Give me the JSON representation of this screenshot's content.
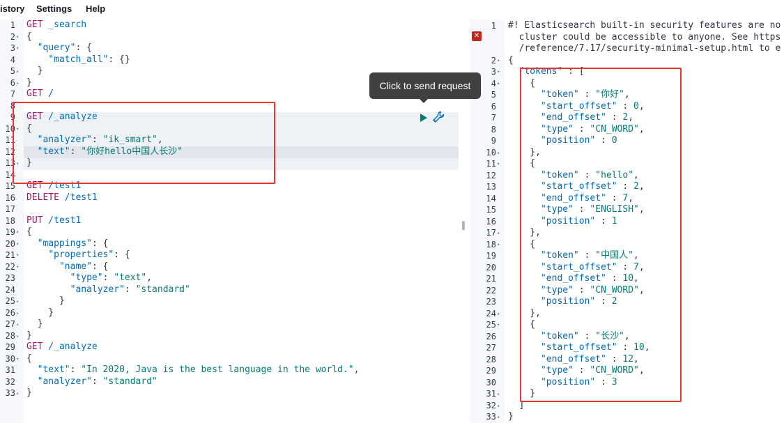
{
  "menu": {
    "history": "istory",
    "settings": "Settings",
    "help": "Help"
  },
  "tooltip": "Click to send request",
  "left_lines": [
    {
      "n": "1",
      "f": "",
      "t": [
        [
          "k",
          "GET"
        ],
        [
          "p",
          " _search"
        ]
      ]
    },
    {
      "n": "2",
      "f": "▾",
      "t": [
        [
          "d",
          "{"
        ]
      ]
    },
    {
      "n": "3",
      "f": "▾",
      "t": [
        [
          "d",
          "  "
        ],
        [
          "p",
          "\"query\""
        ],
        [
          "d",
          ": {"
        ]
      ]
    },
    {
      "n": "4",
      "f": "",
      "t": [
        [
          "d",
          "    "
        ],
        [
          "p",
          "\"match_all\""
        ],
        [
          "d",
          ": {}"
        ]
      ]
    },
    {
      "n": "5",
      "f": "▴",
      "t": [
        [
          "d",
          "  }"
        ]
      ]
    },
    {
      "n": "6",
      "f": "▴",
      "t": [
        [
          "d",
          "}"
        ]
      ]
    },
    {
      "n": "7",
      "f": "",
      "t": [
        [
          "k",
          "GET"
        ],
        [
          "p",
          " /"
        ]
      ]
    },
    {
      "n": "8",
      "f": "",
      "t": []
    },
    {
      "n": "9",
      "f": "",
      "t": [
        [
          "k",
          "GET"
        ],
        [
          "p",
          " /_analyze"
        ]
      ]
    },
    {
      "n": "10",
      "f": "▾",
      "t": [
        [
          "d",
          "{"
        ]
      ]
    },
    {
      "n": "11",
      "f": "",
      "t": [
        [
          "d",
          "  "
        ],
        [
          "p",
          "\"analyzer\""
        ],
        [
          "d",
          ": "
        ],
        [
          "s",
          "\"ik_smart\""
        ],
        [
          "d",
          ","
        ]
      ]
    },
    {
      "n": "12",
      "f": "",
      "t": [
        [
          "d",
          "  "
        ],
        [
          "p",
          "\"text\""
        ],
        [
          "d",
          ": "
        ],
        [
          "s",
          "\"你好hello中国人长沙\""
        ]
      ]
    },
    {
      "n": "13",
      "f": "▴",
      "t": [
        [
          "d",
          "}"
        ]
      ]
    },
    {
      "n": "14",
      "f": "",
      "t": []
    },
    {
      "n": "15",
      "f": "",
      "t": [
        [
          "k",
          "GET"
        ],
        [
          "p",
          " /test1"
        ]
      ]
    },
    {
      "n": "16",
      "f": "",
      "t": [
        [
          "k",
          "DELETE"
        ],
        [
          "p",
          " /test1"
        ]
      ]
    },
    {
      "n": "17",
      "f": "",
      "t": []
    },
    {
      "n": "18",
      "f": "",
      "t": [
        [
          "k",
          "PUT"
        ],
        [
          "p",
          " /test1"
        ]
      ]
    },
    {
      "n": "19",
      "f": "▾",
      "t": [
        [
          "d",
          "{"
        ]
      ]
    },
    {
      "n": "20",
      "f": "▾",
      "t": [
        [
          "d",
          "  "
        ],
        [
          "p",
          "\"mappings\""
        ],
        [
          "d",
          ": {"
        ]
      ]
    },
    {
      "n": "21",
      "f": "▾",
      "t": [
        [
          "d",
          "    "
        ],
        [
          "p",
          "\"properties\""
        ],
        [
          "d",
          ": {"
        ]
      ]
    },
    {
      "n": "22",
      "f": "▾",
      "t": [
        [
          "d",
          "      "
        ],
        [
          "p",
          "\"name\""
        ],
        [
          "d",
          ": {"
        ]
      ]
    },
    {
      "n": "23",
      "f": "",
      "t": [
        [
          "d",
          "        "
        ],
        [
          "p",
          "\"type\""
        ],
        [
          "d",
          ": "
        ],
        [
          "s",
          "\"text\""
        ],
        [
          "d",
          ","
        ]
      ]
    },
    {
      "n": "24",
      "f": "",
      "t": [
        [
          "d",
          "        "
        ],
        [
          "p",
          "\"analyzer\""
        ],
        [
          "d",
          ": "
        ],
        [
          "s",
          "\"standard\""
        ]
      ]
    },
    {
      "n": "25",
      "f": "▴",
      "t": [
        [
          "d",
          "      }"
        ]
      ]
    },
    {
      "n": "26",
      "f": "▴",
      "t": [
        [
          "d",
          "    }"
        ]
      ]
    },
    {
      "n": "27",
      "f": "▴",
      "t": [
        [
          "d",
          "  }"
        ]
      ]
    },
    {
      "n": "28",
      "f": "▴",
      "t": [
        [
          "d",
          "}"
        ]
      ]
    },
    {
      "n": "29",
      "f": "",
      "t": [
        [
          "k",
          "GET"
        ],
        [
          "p",
          " /_analyze"
        ]
      ]
    },
    {
      "n": "30",
      "f": "▾",
      "t": [
        [
          "d",
          "{"
        ]
      ]
    },
    {
      "n": "31",
      "f": "",
      "t": [
        [
          "d",
          "  "
        ],
        [
          "p",
          "\"text\""
        ],
        [
          "d",
          ": "
        ],
        [
          "s",
          "\"In 2020, Java is the best language in the world.\""
        ],
        [
          "d",
          ","
        ]
      ]
    },
    {
      "n": "32",
      "f": "",
      "t": [
        [
          "d",
          "  "
        ],
        [
          "p",
          "\"analyzer\""
        ],
        [
          "d",
          ": "
        ],
        [
          "s",
          "\"standard\""
        ]
      ]
    },
    {
      "n": "33",
      "f": "▴",
      "t": [
        [
          "d",
          "}"
        ]
      ]
    }
  ],
  "right_lines": [
    {
      "n": "1",
      "f": "",
      "t": [
        [
          "c",
          "#! Elasticsearch built-in security features are no"
        ]
      ]
    },
    {
      "n": "",
      "f": "",
      "t": [
        [
          "c",
          "  cluster could be accessible to anyone. See https"
        ]
      ]
    },
    {
      "n": "",
      "f": "",
      "t": [
        [
          "c",
          "  /reference/7.17/security-minimal-setup.html to e"
        ]
      ]
    },
    {
      "n": "2",
      "f": "▾",
      "t": [
        [
          "d",
          "{"
        ]
      ]
    },
    {
      "n": "3",
      "f": "▾",
      "t": [
        [
          "d",
          "  "
        ],
        [
          "p",
          "\"tokens\""
        ],
        [
          "d",
          " : ["
        ]
      ]
    },
    {
      "n": "4",
      "f": "▾",
      "t": [
        [
          "d",
          "    {"
        ]
      ]
    },
    {
      "n": "5",
      "f": "",
      "t": [
        [
          "d",
          "      "
        ],
        [
          "p",
          "\"token\""
        ],
        [
          "d",
          " : "
        ],
        [
          "s",
          "\"你好\""
        ],
        [
          "d",
          ","
        ]
      ]
    },
    {
      "n": "6",
      "f": "",
      "t": [
        [
          "d",
          "      "
        ],
        [
          "p",
          "\"start_offset\""
        ],
        [
          "d",
          " : "
        ],
        [
          "n",
          "0"
        ],
        [
          "d",
          ","
        ]
      ]
    },
    {
      "n": "7",
      "f": "",
      "t": [
        [
          "d",
          "      "
        ],
        [
          "p",
          "\"end_offset\""
        ],
        [
          "d",
          " : "
        ],
        [
          "n",
          "2"
        ],
        [
          "d",
          ","
        ]
      ]
    },
    {
      "n": "8",
      "f": "",
      "t": [
        [
          "d",
          "      "
        ],
        [
          "p",
          "\"type\""
        ],
        [
          "d",
          " : "
        ],
        [
          "s",
          "\"CN_WORD\""
        ],
        [
          "d",
          ","
        ]
      ]
    },
    {
      "n": "9",
      "f": "",
      "t": [
        [
          "d",
          "      "
        ],
        [
          "p",
          "\"position\""
        ],
        [
          "d",
          " : "
        ],
        [
          "n",
          "0"
        ]
      ]
    },
    {
      "n": "10",
      "f": "▴",
      "t": [
        [
          "d",
          "    },"
        ]
      ]
    },
    {
      "n": "11",
      "f": "▾",
      "t": [
        [
          "d",
          "    {"
        ]
      ]
    },
    {
      "n": "12",
      "f": "",
      "t": [
        [
          "d",
          "      "
        ],
        [
          "p",
          "\"token\""
        ],
        [
          "d",
          " : "
        ],
        [
          "s",
          "\"hello\""
        ],
        [
          "d",
          ","
        ]
      ]
    },
    {
      "n": "13",
      "f": "",
      "t": [
        [
          "d",
          "      "
        ],
        [
          "p",
          "\"start_offset\""
        ],
        [
          "d",
          " : "
        ],
        [
          "n",
          "2"
        ],
        [
          "d",
          ","
        ]
      ]
    },
    {
      "n": "14",
      "f": "",
      "t": [
        [
          "d",
          "      "
        ],
        [
          "p",
          "\"end_offset\""
        ],
        [
          "d",
          " : "
        ],
        [
          "n",
          "7"
        ],
        [
          "d",
          ","
        ]
      ]
    },
    {
      "n": "15",
      "f": "",
      "t": [
        [
          "d",
          "      "
        ],
        [
          "p",
          "\"type\""
        ],
        [
          "d",
          " : "
        ],
        [
          "s",
          "\"ENGLISH\""
        ],
        [
          "d",
          ","
        ]
      ]
    },
    {
      "n": "16",
      "f": "",
      "t": [
        [
          "d",
          "      "
        ],
        [
          "p",
          "\"position\""
        ],
        [
          "d",
          " : "
        ],
        [
          "n",
          "1"
        ]
      ]
    },
    {
      "n": "17",
      "f": "▴",
      "t": [
        [
          "d",
          "    },"
        ]
      ]
    },
    {
      "n": "18",
      "f": "▾",
      "t": [
        [
          "d",
          "    {"
        ]
      ]
    },
    {
      "n": "19",
      "f": "",
      "t": [
        [
          "d",
          "      "
        ],
        [
          "p",
          "\"token\""
        ],
        [
          "d",
          " : "
        ],
        [
          "s",
          "\"中国人\""
        ],
        [
          "d",
          ","
        ]
      ]
    },
    {
      "n": "20",
      "f": "",
      "t": [
        [
          "d",
          "      "
        ],
        [
          "p",
          "\"start_offset\""
        ],
        [
          "d",
          " : "
        ],
        [
          "n",
          "7"
        ],
        [
          "d",
          ","
        ]
      ]
    },
    {
      "n": "21",
      "f": "",
      "t": [
        [
          "d",
          "      "
        ],
        [
          "p",
          "\"end_offset\""
        ],
        [
          "d",
          " : "
        ],
        [
          "n",
          "10"
        ],
        [
          "d",
          ","
        ]
      ]
    },
    {
      "n": "22",
      "f": "",
      "t": [
        [
          "d",
          "      "
        ],
        [
          "p",
          "\"type\""
        ],
        [
          "d",
          " : "
        ],
        [
          "s",
          "\"CN_WORD\""
        ],
        [
          "d",
          ","
        ]
      ]
    },
    {
      "n": "23",
      "f": "",
      "t": [
        [
          "d",
          "      "
        ],
        [
          "p",
          "\"position\""
        ],
        [
          "d",
          " : "
        ],
        [
          "n",
          "2"
        ]
      ]
    },
    {
      "n": "24",
      "f": "▴",
      "t": [
        [
          "d",
          "    },"
        ]
      ]
    },
    {
      "n": "25",
      "f": "▾",
      "t": [
        [
          "d",
          "    {"
        ]
      ]
    },
    {
      "n": "26",
      "f": "",
      "t": [
        [
          "d",
          "      "
        ],
        [
          "p",
          "\"token\""
        ],
        [
          "d",
          " : "
        ],
        [
          "s",
          "\"长沙\""
        ],
        [
          "d",
          ","
        ]
      ]
    },
    {
      "n": "27",
      "f": "",
      "t": [
        [
          "d",
          "      "
        ],
        [
          "p",
          "\"start_offset\""
        ],
        [
          "d",
          " : "
        ],
        [
          "n",
          "10"
        ],
        [
          "d",
          ","
        ]
      ]
    },
    {
      "n": "28",
      "f": "",
      "t": [
        [
          "d",
          "      "
        ],
        [
          "p",
          "\"end_offset\""
        ],
        [
          "d",
          " : "
        ],
        [
          "n",
          "12"
        ],
        [
          "d",
          ","
        ]
      ]
    },
    {
      "n": "29",
      "f": "",
      "t": [
        [
          "d",
          "      "
        ],
        [
          "p",
          "\"type\""
        ],
        [
          "d",
          " : "
        ],
        [
          "s",
          "\"CN_WORD\""
        ],
        [
          "d",
          ","
        ]
      ]
    },
    {
      "n": "30",
      "f": "",
      "t": [
        [
          "d",
          "      "
        ],
        [
          "p",
          "\"position\""
        ],
        [
          "d",
          " : "
        ],
        [
          "n",
          "3"
        ]
      ]
    },
    {
      "n": "31",
      "f": "▴",
      "t": [
        [
          "d",
          "    }"
        ]
      ]
    },
    {
      "n": "32",
      "f": "▴",
      "t": [
        [
          "d",
          "  ]"
        ]
      ]
    },
    {
      "n": "33",
      "f": "▴",
      "t": [
        [
          "d",
          "}"
        ]
      ]
    }
  ],
  "colors": {
    "highlight_box": "#e8362f",
    "method": "#a0146e",
    "key": "#006bb8",
    "string": "#017d73"
  },
  "icons": {
    "send": "play-icon",
    "wrench": "wrench-icon",
    "error": "error-icon"
  }
}
